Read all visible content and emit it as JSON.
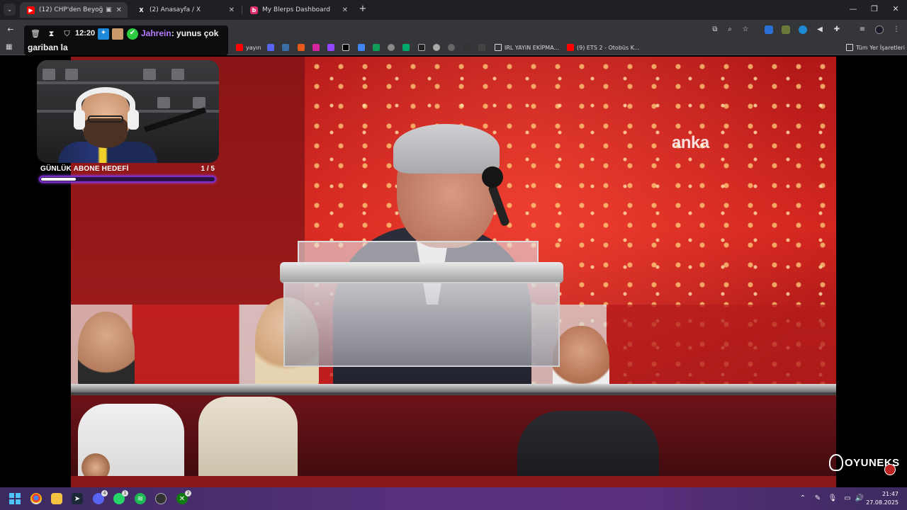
{
  "browser": {
    "tabs": [
      {
        "label": "(12) CHP'den Beyoğlu'nda",
        "icon": "youtube-icon",
        "active": true
      },
      {
        "label": "(2) Anasayfa / X",
        "icon": "x-icon",
        "active": false
      },
      {
        "label": "My Blerps Dashboard",
        "icon": "blerp-icon",
        "active": false
      }
    ],
    "bookmarks": [
      {
        "label": "yayın",
        "icon": "youtube-icon"
      },
      {
        "label": "IRL YAYIN EKİPMA...",
        "icon": "folder-icon"
      },
      {
        "label": "(9) ETS 2 - Otobüs K...",
        "icon": "youtube-icon"
      },
      {
        "label": "Tüm Yer İşaretleri",
        "icon": "folder-icon"
      }
    ]
  },
  "video": {
    "watermark": "anka"
  },
  "chat": {
    "time": "12:20",
    "username": "Jahrein",
    "username_color": "#b57bff",
    "message_part1": ": yunus çok",
    "message_part2": "gariban la"
  },
  "subgoal": {
    "label": "GÜNLÜK ABONE HEDEFİ",
    "count": "1  / 5",
    "current": 1,
    "target": 5,
    "accent": "#7d2fd0"
  },
  "logo": {
    "text": "OYUNEKS"
  },
  "taskbar": {
    "time": "21:47",
    "date": "27.08.2025",
    "badges": {
      "discord": "4",
      "whatsapp": "1",
      "xbox": "2"
    }
  }
}
